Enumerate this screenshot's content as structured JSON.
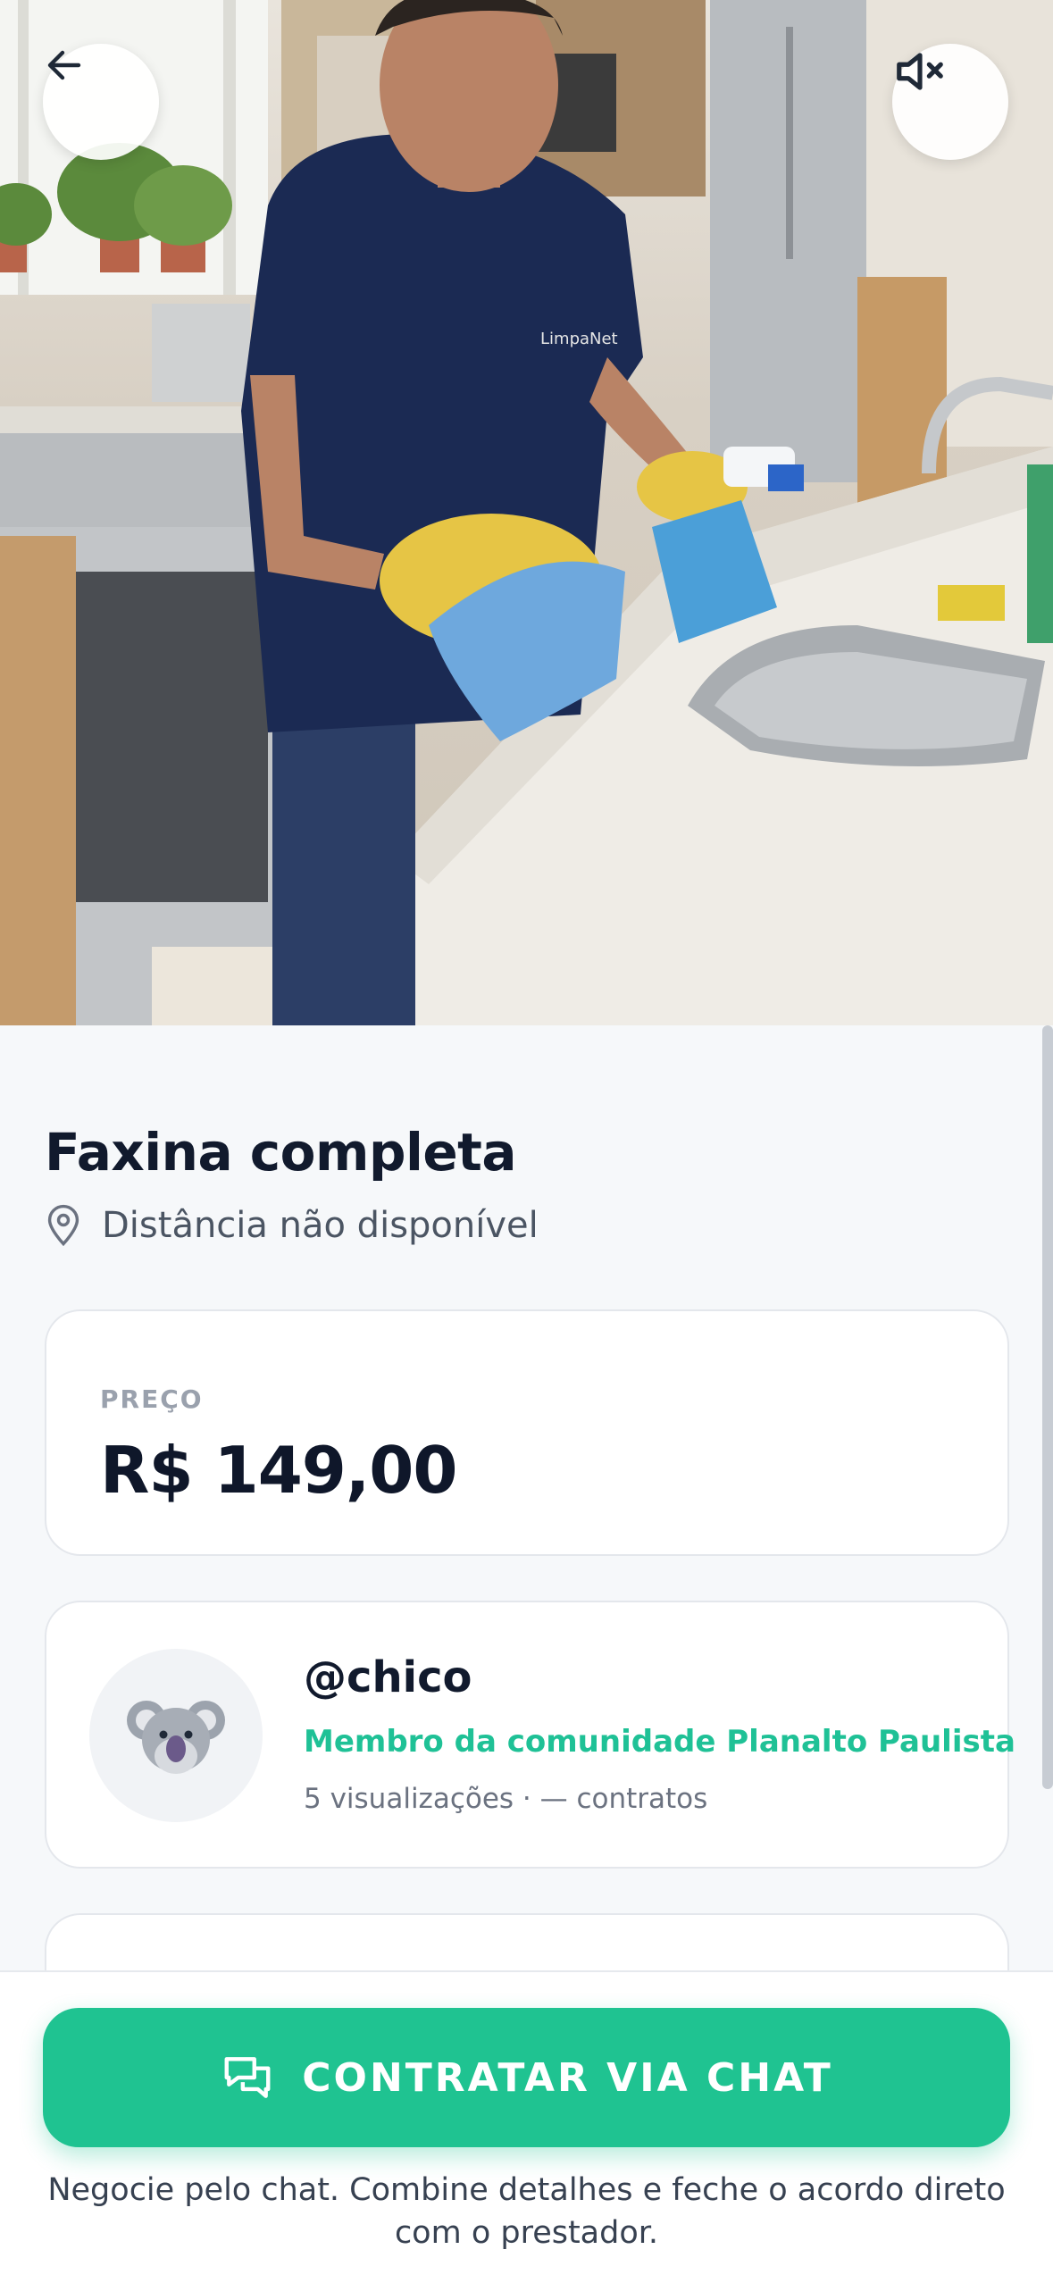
{
  "header": {
    "back_icon": "arrow-left-icon",
    "mute_icon": "volume-muted-icon"
  },
  "hero": {
    "media": "video-preview",
    "description_icon": "cleaning-photo"
  },
  "service": {
    "title": "Faxina completa",
    "distance_icon": "location-pin-icon",
    "distance": "Distância não disponível"
  },
  "price": {
    "label": "PREÇO",
    "value": "R$ 149,00"
  },
  "provider": {
    "avatar_icon": "koala-icon",
    "handle": "@chico",
    "community": "Membro da comunidade Planalto Paulista",
    "stats": "5 visualizações · — contratos"
  },
  "cta": {
    "icon": "chat-bubbles-icon",
    "label": "CONTRATAR VIA CHAT",
    "helper": "Negocie pelo chat. Combine detalhes e feche o acordo direto com o prestador."
  },
  "colors": {
    "accent": "#1fc391",
    "community_text": "#1fc196",
    "title": "#111a2d",
    "background": "#f6f8fa"
  }
}
